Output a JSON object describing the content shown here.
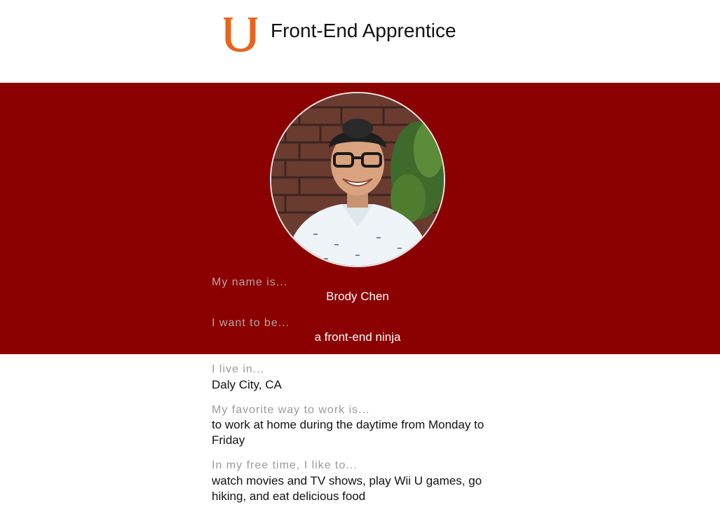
{
  "header": {
    "logo_icon": "letter-u-logo-icon",
    "logo_color": "#e8641e",
    "title": "Front-End Apprentice"
  },
  "hero": {
    "background_color": "#8b0000",
    "avatar_icon": "profile-photo",
    "name_label": "My name is...",
    "name_value": "Brody Chen",
    "goal_label": "I want to be...",
    "goal_value": "a front-end ninja"
  },
  "details": {
    "location_label": "I live in...",
    "location_value": "Daly City, CA",
    "work_label": "My favorite way to work is...",
    "work_value": "to work at home during the daytime from Monday to Friday",
    "free_time_label": "In my free time, I like to...",
    "free_time_value": "watch movies and TV shows, play Wii U games, go hiking, and eat delicious food"
  }
}
